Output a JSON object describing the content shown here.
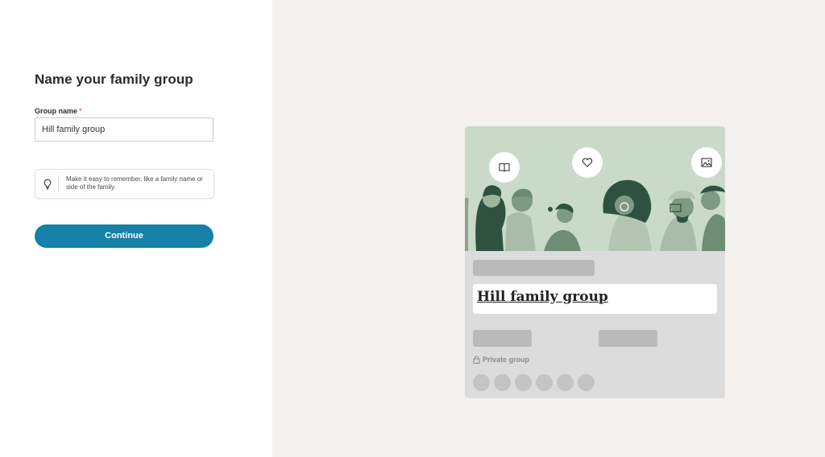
{
  "form": {
    "title": "Name your family group",
    "group_name_label": "Group name",
    "required_marker": "*",
    "group_name_value": "Hill family group",
    "tip_text": "Make it easy to remember, like a family name or side of the family.",
    "tip_icon": "lightbulb-icon",
    "continue_label": "Continue"
  },
  "preview": {
    "group_name": "Hill family group",
    "privacy_label": "Private group",
    "privacy_icon": "lock-icon",
    "bubble_icons": [
      "book-icon",
      "heart-icon",
      "image-icon"
    ],
    "member_avatar_count": 6
  },
  "colors": {
    "accent": "#1580a8",
    "required": "#c4302b",
    "illustration_bg": "#c9dac8",
    "page_bg": "#f5f1ee"
  }
}
